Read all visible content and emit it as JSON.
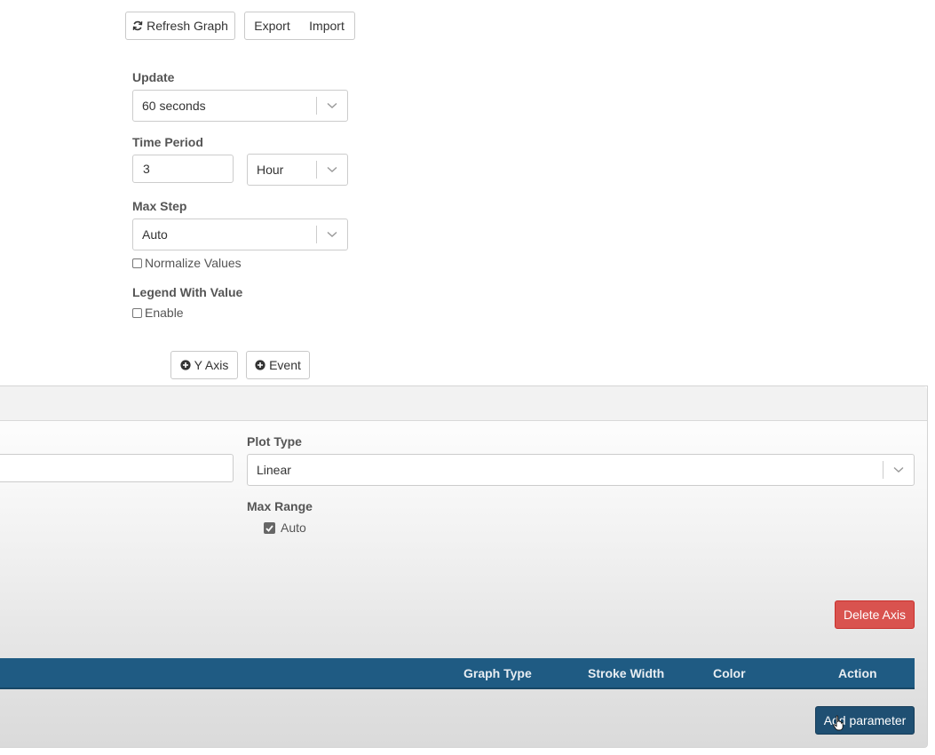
{
  "toolbar": {
    "refresh_label": "Refresh Graph",
    "export_label": "Export",
    "import_label": "Import"
  },
  "settings": {
    "update_label": "Update",
    "update_value": "60 seconds",
    "time_period_label": "Time Period",
    "time_period_value": "3",
    "time_period_unit": "Hour",
    "max_step_label": "Max Step",
    "max_step_value": "Auto",
    "normalize_label": "Normalize Values",
    "legend_label": "Legend With Value",
    "legend_enable_label": "Enable"
  },
  "add_buttons": {
    "y_axis_label": "Y Axis",
    "event_label": "Event"
  },
  "axis_panel": {
    "plot_type_label": "Plot Type",
    "plot_type_value": "Linear",
    "max_range_label": "Max Range",
    "max_range_auto_label": "Auto",
    "delete_axis_label": "Delete Axis"
  },
  "parameters_table": {
    "columns": [
      "Graph Type",
      "Stroke Width",
      "Color",
      "Action"
    ],
    "add_parameter_label": "Add parameter"
  },
  "colors": {
    "table_header": "#1f5b83",
    "danger": "#d9534f",
    "primary": "#1f4f72"
  }
}
